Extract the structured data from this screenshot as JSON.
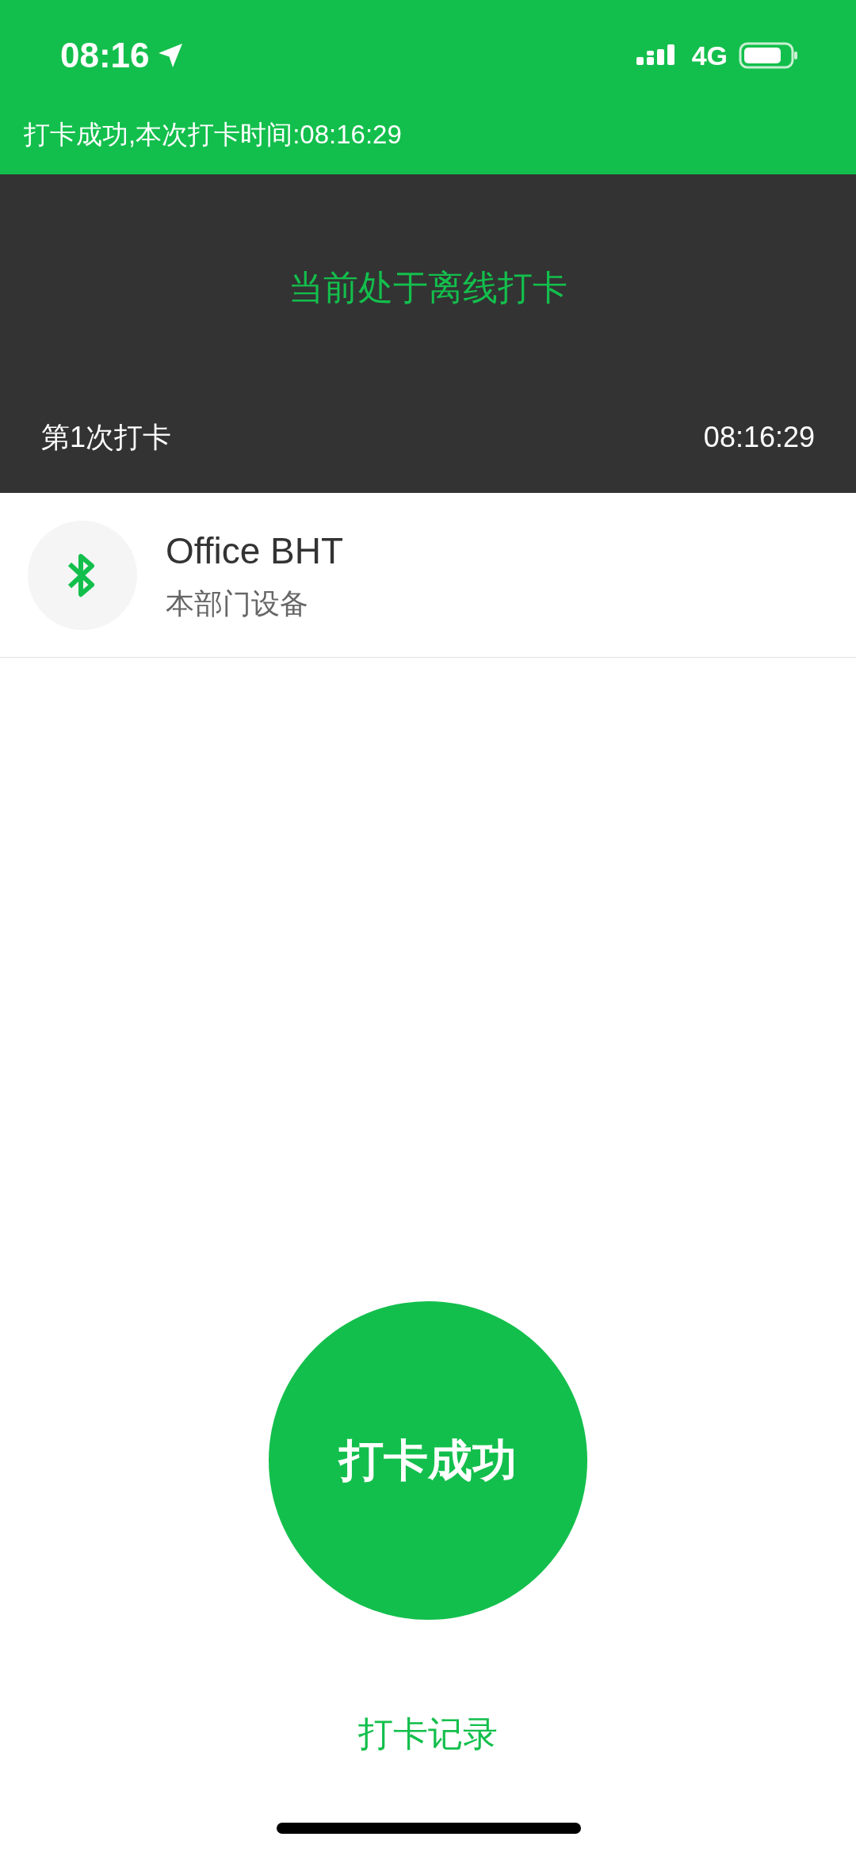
{
  "status_bar": {
    "time": "08:16",
    "network": "4G"
  },
  "notification": "打卡成功,本次打卡时间:08:16:29",
  "banner": {
    "title": "当前处于离线打卡",
    "punch_label": "第1次打卡",
    "punch_time": "08:16:29"
  },
  "device": {
    "name": "Office BHT",
    "subtitle": "本部门设备"
  },
  "punch_button": "打卡成功",
  "records_link": "打卡记录"
}
